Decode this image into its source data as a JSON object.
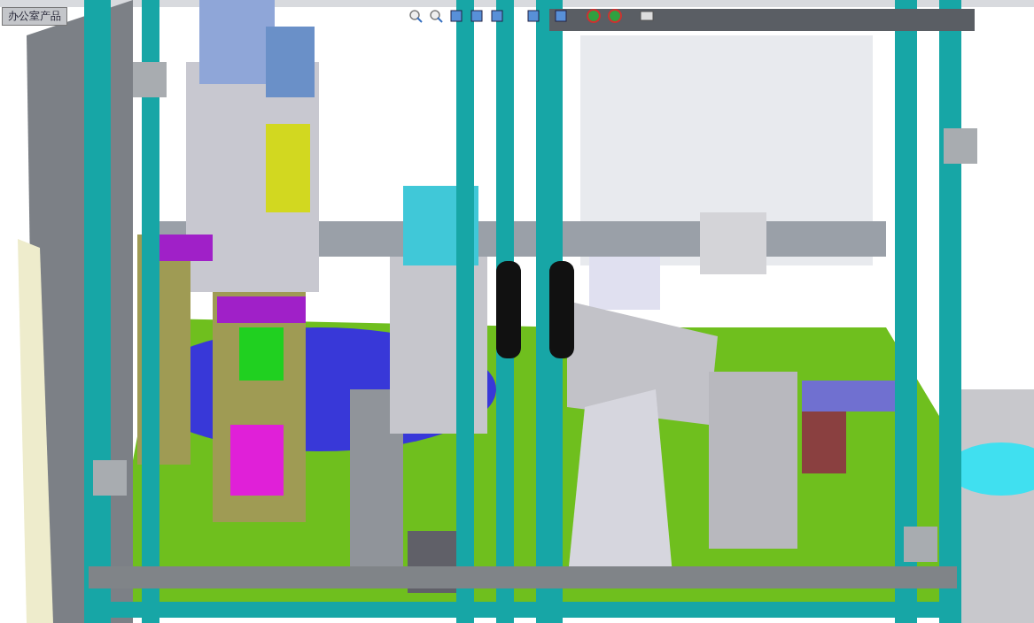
{
  "feature_tab": {
    "label": "办公室产品"
  }
}
